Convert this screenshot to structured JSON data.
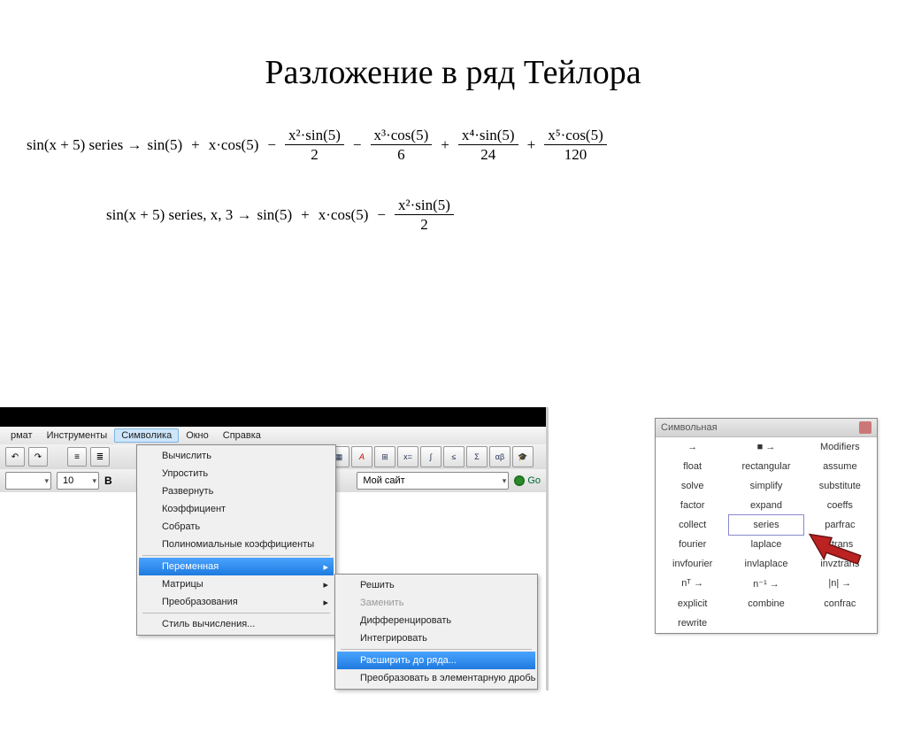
{
  "slide": {
    "title": "Разложение в ряд Тейлора"
  },
  "eq1": {
    "lhs": "sin(x + 5)  series  →",
    "t1": "sin(5)",
    "t2": "x·cos(5)",
    "f1n": "x²·sin(5)",
    "f1d": "2",
    "f2n": "x³·cos(5)",
    "f2d": "6",
    "f3n": "x⁴·sin(5)",
    "f3d": "24",
    "f4n": "x⁵·cos(5)",
    "f4d": "120"
  },
  "eq2": {
    "lhs": "sin(x + 5)  series, x, 3  →",
    "t1": "sin(5)",
    "t2": "x·cos(5)",
    "f1n": "x²·sin(5)",
    "f1d": "2"
  },
  "menubar": {
    "m0": "рмат",
    "m1": "Инструменты",
    "m2": "Символика",
    "m3": "Окно",
    "m4": "Справка"
  },
  "toolbar2": {
    "font_size": "10",
    "bold": "B",
    "site": "Мой сайт",
    "go": "Go"
  },
  "dd1": {
    "i0": "Вычислить",
    "i1": "Упростить",
    "i2": "Развернуть",
    "i3": "Коэффициент",
    "i4": "Собрать",
    "i5": "Полиномиальные коэффициенты",
    "i6": "Переменная",
    "i7": "Матрицы",
    "i8": "Преобразования",
    "i9": "Стиль вычисления..."
  },
  "dd2": {
    "i0": "Решить",
    "i1": "Заменить",
    "i2": "Дифференцировать",
    "i3": "Интегрировать",
    "i4": "Расширить до ряда...",
    "i5": "Преобразовать в элементарную дробь"
  },
  "sym": {
    "title": "Символьная",
    "cells": [
      "→",
      "■ →",
      "Modifiers",
      "float",
      "rectangular",
      "assume",
      "solve",
      "simplify",
      "substitute",
      "factor",
      "expand",
      "coeffs",
      "collect",
      "series",
      "parfrac",
      "fourier",
      "laplace",
      "ztrans",
      "invfourier",
      "invlaplace",
      "invztrans",
      "nᵀ →",
      "n⁻¹ →",
      "|n| →",
      "explicit",
      "combine",
      "confrac",
      "rewrite",
      "",
      ""
    ]
  }
}
